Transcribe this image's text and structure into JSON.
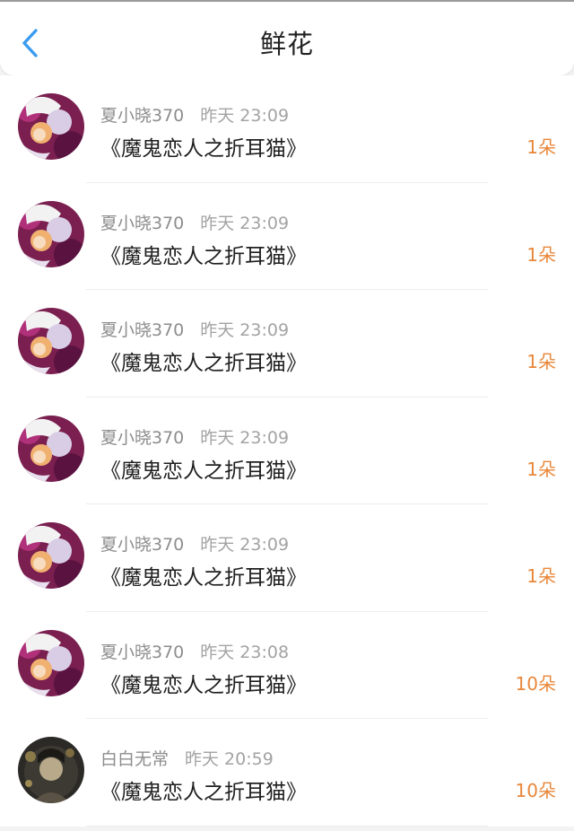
{
  "header": {
    "title": "鲜花",
    "back_icon": "chevron-left-icon"
  },
  "colors": {
    "accent": "#3a9cf0",
    "count": "#e8873a"
  },
  "items": [
    {
      "user": "夏小晓370",
      "time": "昨天 23:09",
      "book": "《魔鬼恋人之折耳猫》",
      "count": "1朵",
      "avatar": "anime-avatar"
    },
    {
      "user": "夏小晓370",
      "time": "昨天 23:09",
      "book": "《魔鬼恋人之折耳猫》",
      "count": "1朵",
      "avatar": "anime-avatar"
    },
    {
      "user": "夏小晓370",
      "time": "昨天 23:09",
      "book": "《魔鬼恋人之折耳猫》",
      "count": "1朵",
      "avatar": "anime-avatar"
    },
    {
      "user": "夏小晓370",
      "time": "昨天 23:09",
      "book": "《魔鬼恋人之折耳猫》",
      "count": "1朵",
      "avatar": "anime-avatar"
    },
    {
      "user": "夏小晓370",
      "time": "昨天 23:09",
      "book": "《魔鬼恋人之折耳猫》",
      "count": "1朵",
      "avatar": "anime-avatar"
    },
    {
      "user": "夏小晓370",
      "time": "昨天 23:08",
      "book": "《魔鬼恋人之折耳猫》",
      "count": "10朵",
      "avatar": "anime-avatar"
    },
    {
      "user": "白白无常",
      "time": "昨天 20:59",
      "book": "《魔鬼恋人之折耳猫》",
      "count": "10朵",
      "avatar": "dark-avatar"
    }
  ]
}
